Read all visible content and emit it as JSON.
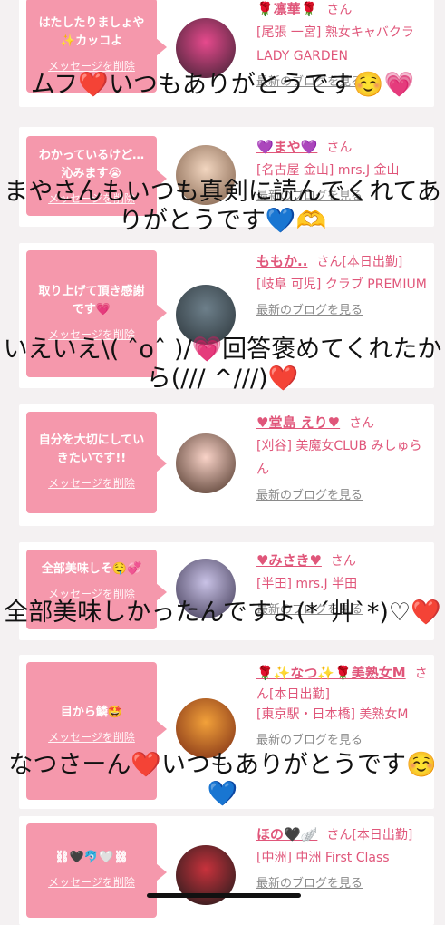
{
  "cards": [
    {
      "message": "はたしたりましょや✨カッコよ",
      "delete_label": "メッセージを削除",
      "name": "🌹凛華🌹",
      "san": "さん",
      "shop": "[尾張 一宮] 熟女キャバクラ LADY GARDEN",
      "blog": "最新のブログを見る",
      "avatar_colors": [
        "#e64a8d",
        "#3a2030"
      ]
    },
    {
      "message": "わかっているけど…沁みます😭",
      "delete_label": "メッセージを削除",
      "name": "💜まや💜",
      "san": "さん",
      "shop": "[名古屋 金山] mrs.J 金山",
      "blog": "最新のブログを見る",
      "avatar_colors": [
        "#f2d6c0",
        "#7a5a44"
      ]
    },
    {
      "message": "取り上げて頂き感謝です💗",
      "delete_label": "メッセージを削除",
      "name": "ももか..",
      "san": "さん[本日出勤]",
      "shop": "[岐阜 可児] クラブ PREMIUM",
      "blog": "最新のブログを見る",
      "avatar_colors": [
        "#6d7f8a",
        "#2a3338"
      ]
    },
    {
      "message": "自分を大切にしていきたいです!!",
      "delete_label": "メッセージを削除",
      "name": "♥堂島 えり♥",
      "san": "さん",
      "shop": "[刈谷] 美魔女CLUB みしゅらん",
      "blog": "最新のブログを見る",
      "avatar_colors": [
        "#f9d3c8",
        "#4a3226"
      ]
    },
    {
      "message": "全部美味しそ🤤💞",
      "delete_label": "メッセージを削除",
      "name": "♥みさき♥",
      "san": "さん",
      "shop": "[半田] mrs.J 半田",
      "blog": "最新のブログを見る",
      "avatar_colors": [
        "#c9c2e6",
        "#3c3550"
      ]
    },
    {
      "message": "目から鱗🤩",
      "delete_label": "メッセージを削除",
      "name": "🌹✨なつ✨🌹美熟女M",
      "san": "さん[本日出勤]",
      "shop": "[東京駅・日本橋] 美熟女M",
      "blog": "最新のブログを見る",
      "avatar_colors": [
        "#f2a13a",
        "#7a2a14"
      ]
    },
    {
      "message": "⛓🖤🐬🤍⛓",
      "delete_label": "メッセージを削除",
      "name": "ほの🖤🪽",
      "san": "さん[本日出勤]",
      "shop": "[中洲] 中洲 First Class",
      "blog": "最新のブログを見る",
      "avatar_colors": [
        "#c8323c",
        "#1a1a1a"
      ]
    }
  ],
  "overlays": [
    "ムフ❤️いつもありがとうです☺️💗",
    "まやさんもいつも真剣に読んでくれてありがとうです💙🫶",
    "いえいえ\\( ˆoˆ )/💗回答褒めてくれたから(/// ^///)❤️",
    "全部美味しかったんですよ(*´艸`*)♡❤️",
    "なつさーん❤️いつもありがとうです☺️💙"
  ]
}
